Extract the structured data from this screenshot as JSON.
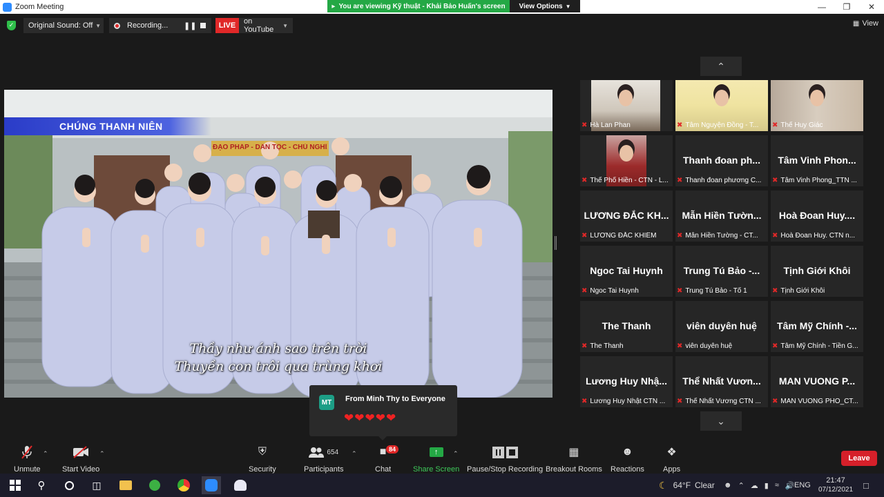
{
  "window": {
    "title": "Zoom Meeting"
  },
  "share_banner": {
    "text": "You are viewing Kỹ thuật - Khải Bảo Huấn's screen",
    "view_options": "View Options"
  },
  "topbar": {
    "original_sound": "Original Sound: Off",
    "recording": "Recording...",
    "live": "LIVE",
    "live_target": "on YouTube",
    "view": "View"
  },
  "shared_video": {
    "banner": "CHÚNG THANH NIÊN",
    "sign": "ĐẠO PHÁP - DÂN TỘC - CHỦ NGHĨA XÃ",
    "subtitle_line1": "Thầy như ánh sao trên trời",
    "subtitle_line2": "Thuyền con trôi qua trùng khơi"
  },
  "participants": [
    {
      "name": "Hà Lan Phan",
      "has_video": true
    },
    {
      "name": "Tâm Nguyện Đồng - T...",
      "has_video": true
    },
    {
      "name": "Thể Huy Giác",
      "has_video": true
    },
    {
      "name": "Thể Phổ Hiền - CTN - L...",
      "has_video": true
    },
    {
      "big": "Thanh đoan ph...",
      "name": "Thanh đoan phương C..."
    },
    {
      "big": "Tâm Vinh Phon...",
      "name": "Tâm Vinh Phong_TTN ..."
    },
    {
      "big": "LƯƠNG ĐẮC KH...",
      "name": "LƯƠNG ĐẮC KHIÊM"
    },
    {
      "big": "Mẫn Hiền Tườn...",
      "name": "Mẫn Hiền Tường - CT..."
    },
    {
      "big": "Hoà Đoan Huy....",
      "name": "Hoà Đoan Huy. CTN n..."
    },
    {
      "big": "Ngoc Tai Huynh",
      "name": "Ngoc Tai Huynh"
    },
    {
      "big": "Trung Tú Bảo -...",
      "name": "Trung Tú Bảo - Tổ 1"
    },
    {
      "big": "Tịnh Giới Khôi",
      "name": "Tịnh Giới Khôi"
    },
    {
      "big": "The Thanh",
      "name": "The Thanh"
    },
    {
      "big": "viên duyên huệ",
      "name": "viên duyên huệ"
    },
    {
      "big": "Tâm Mỹ Chính -...",
      "name": "Tâm Mỹ Chính - Tiền G..."
    },
    {
      "big": "Lương Huy Nhậ...",
      "name": "Lương Huy Nhật CTN ..."
    },
    {
      "big": "Thể Nhất Vươn...",
      "name": "Thể Nhất Vương CTN ..."
    },
    {
      "big": "MAN VUONG P...",
      "name": "MAN VUONG PHO_CT..."
    }
  ],
  "chat_popup": {
    "initials": "MT",
    "from": "From Minh Thy to Everyone",
    "message": "❤❤❤❤❤"
  },
  "toolbar": {
    "unmute": "Unmute",
    "start_video": "Start Video",
    "security": "Security",
    "participants": "Participants",
    "participants_count": "654",
    "chat": "Chat",
    "chat_badge": "84",
    "share_screen": "Share Screen",
    "pause_stop_recording": "Pause/Stop Recording",
    "breakout_rooms": "Breakout Rooms",
    "reactions": "Reactions",
    "apps": "Apps",
    "leave": "Leave"
  },
  "taskbar": {
    "weather_temp": "64°F",
    "weather_text": "Clear",
    "language": "ENG",
    "time": "21:47",
    "date": "07/12/2021"
  },
  "colors": {
    "zoom_blue": "#2d8cff",
    "share_green": "#24a845",
    "live_red": "#e02828",
    "leave_red": "#d6202a"
  }
}
